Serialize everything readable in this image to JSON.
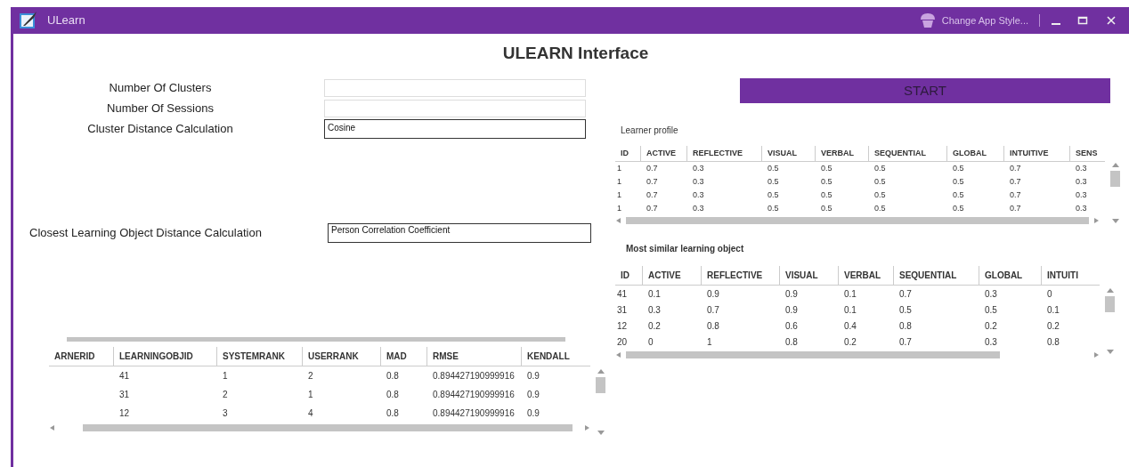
{
  "window": {
    "title": "ULearn",
    "style_button": "Change App Style..."
  },
  "heading": "ULEARN Interface",
  "fields": [
    {
      "label": "Number Of Clusters"
    },
    {
      "label": "Number Of Sessions"
    },
    {
      "label": "Cluster Distance Calculation",
      "value": "Cosine"
    }
  ],
  "closest_field": {
    "label": "Closest Learning Object Distance Calculation",
    "value": "Person Correlation Coefficient"
  },
  "start_button": "START",
  "learner_profile": {
    "title": "Learner profile",
    "columns": [
      "ID",
      "ACTIVE",
      "REFLECTIVE",
      "VISUAL",
      "VERBAL",
      "SEQUENTIAL",
      "GLOBAL",
      "INTUITIVE",
      "SENS"
    ],
    "rows": [
      [
        "1",
        "0.7",
        "0.3",
        "0.5",
        "0.5",
        "0.5",
        "0.5",
        "0.7",
        "0.3"
      ],
      [
        "1",
        "0.7",
        "0.3",
        "0.5",
        "0.5",
        "0.5",
        "0.5",
        "0.7",
        "0.3"
      ],
      [
        "1",
        "0.7",
        "0.3",
        "0.5",
        "0.5",
        "0.5",
        "0.5",
        "0.7",
        "0.3"
      ],
      [
        "1",
        "0.7",
        "0.3",
        "0.5",
        "0.5",
        "0.5",
        "0.5",
        "0.7",
        "0.3"
      ]
    ]
  },
  "similar_objects": {
    "title": "Most similar learning object",
    "columns": [
      "ID",
      "ACTIVE",
      "REFLECTIVE",
      "VISUAL",
      "VERBAL",
      "SEQUENTIAL",
      "GLOBAL",
      "INTUITI"
    ],
    "rows": [
      [
        "41",
        "0.1",
        "0.9",
        "0.9",
        "0.1",
        "0.7",
        "0.3",
        "0"
      ],
      [
        "31",
        "0.3",
        "0.7",
        "0.9",
        "0.1",
        "0.5",
        "0.5",
        "0.1"
      ],
      [
        "12",
        "0.2",
        "0.8",
        "0.6",
        "0.4",
        "0.8",
        "0.2",
        "0.2"
      ],
      [
        "20",
        "0",
        "1",
        "0.8",
        "0.2",
        "0.7",
        "0.3",
        "0.8"
      ]
    ]
  },
  "evaluation": {
    "columns": [
      "ARNERID",
      "LEARNINGOBJID",
      "SYSTEMRANK",
      "USERRANK",
      "MAD",
      "RMSE",
      "KENDALL"
    ],
    "rows": [
      [
        "",
        "41",
        "1",
        "2",
        "0.8",
        "0.894427190999916",
        "0.9"
      ],
      [
        "",
        "31",
        "2",
        "1",
        "0.8",
        "0.894427190999916",
        "0.9"
      ],
      [
        "",
        "12",
        "3",
        "4",
        "0.8",
        "0.894427190999916",
        "0.9"
      ]
    ]
  }
}
